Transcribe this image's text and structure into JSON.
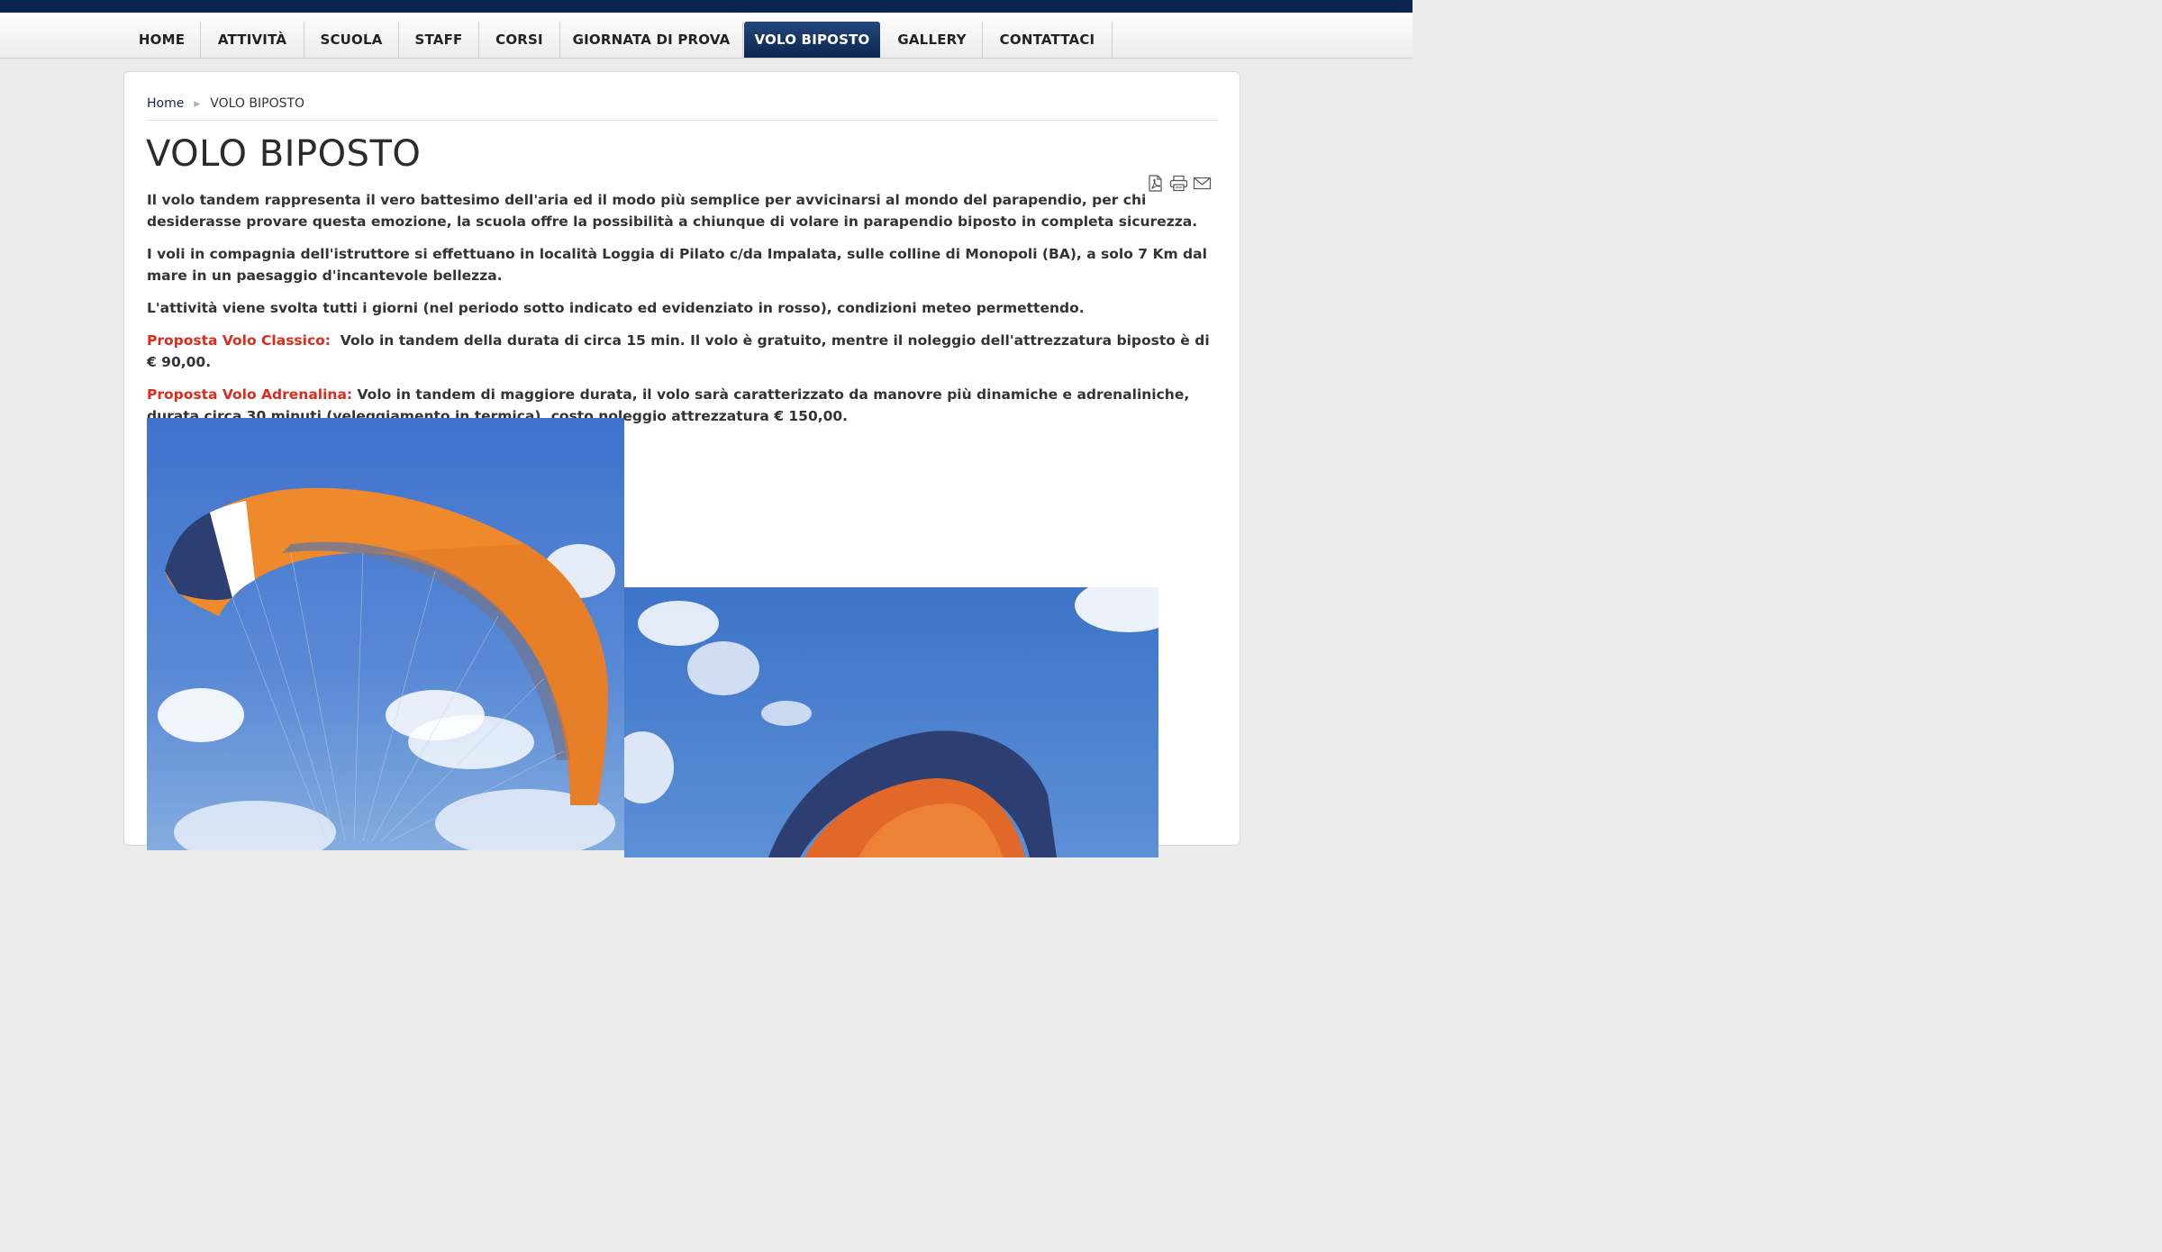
{
  "nav": {
    "items": [
      {
        "label": "HOME"
      },
      {
        "label": "ATTIVITÀ"
      },
      {
        "label": "SCUOLA"
      },
      {
        "label": "STAFF"
      },
      {
        "label": "CORSI"
      },
      {
        "label": "GIORNATA DI PROVA"
      },
      {
        "label": "VOLO BIPOSTO",
        "active": true
      },
      {
        "label": "GALLERY"
      },
      {
        "label": "CONTATTACI"
      }
    ]
  },
  "breadcrumb": {
    "home": "Home",
    "current": "VOLO BIPOSTO"
  },
  "page": {
    "title": "VOLO BIPOSTO",
    "tools": {
      "pdf_icon": "pdf-icon",
      "print_icon": "print-icon",
      "email_icon": "email-icon"
    },
    "paragraphs": [
      "Il volo tandem rappresenta il vero battesimo dell'aria ed il modo più semplice per avvicinarsi al mondo del parapendio, per chi desiderasse provare questa emozione, la scuola offre la possibilità a chiunque di volare in parapendio biposto in completa sicurezza.",
      "I voli in compagnia dell'istruttore si effettuano in località Loggia di Pilato c/da Impalata, sulle colline di Monopoli (BA), a solo 7 Km dal mare in un paesaggio d'incantevole bellezza.",
      "L'attività viene svolta tutti i giorni (nel periodo sotto indicato ed evidenziato in rosso), condizioni meteo permettendo."
    ],
    "offer_classic": {
      "label": "Proposta Volo Classico:",
      "text": "Volo in tandem della durata di circa 15 min. Il volo è gratuito, mentre il noleggio dell'attrezzatura biposto è di € 90,00."
    },
    "offer_adrenaline": {
      "label": "Proposta Volo Adrenalina:",
      "text": "Volo in tandem di maggiore durata, il volo sarà caratterizzato da manovre più dinamiche e adrenaliniche, durata circa 30 minuti (veleggiamento in termica), costo noleggio attrezzatura € 150,00."
    }
  },
  "colors": {
    "brand_navy": "#0c2550",
    "accent_red": "#e02a1c",
    "text": "#333333"
  }
}
